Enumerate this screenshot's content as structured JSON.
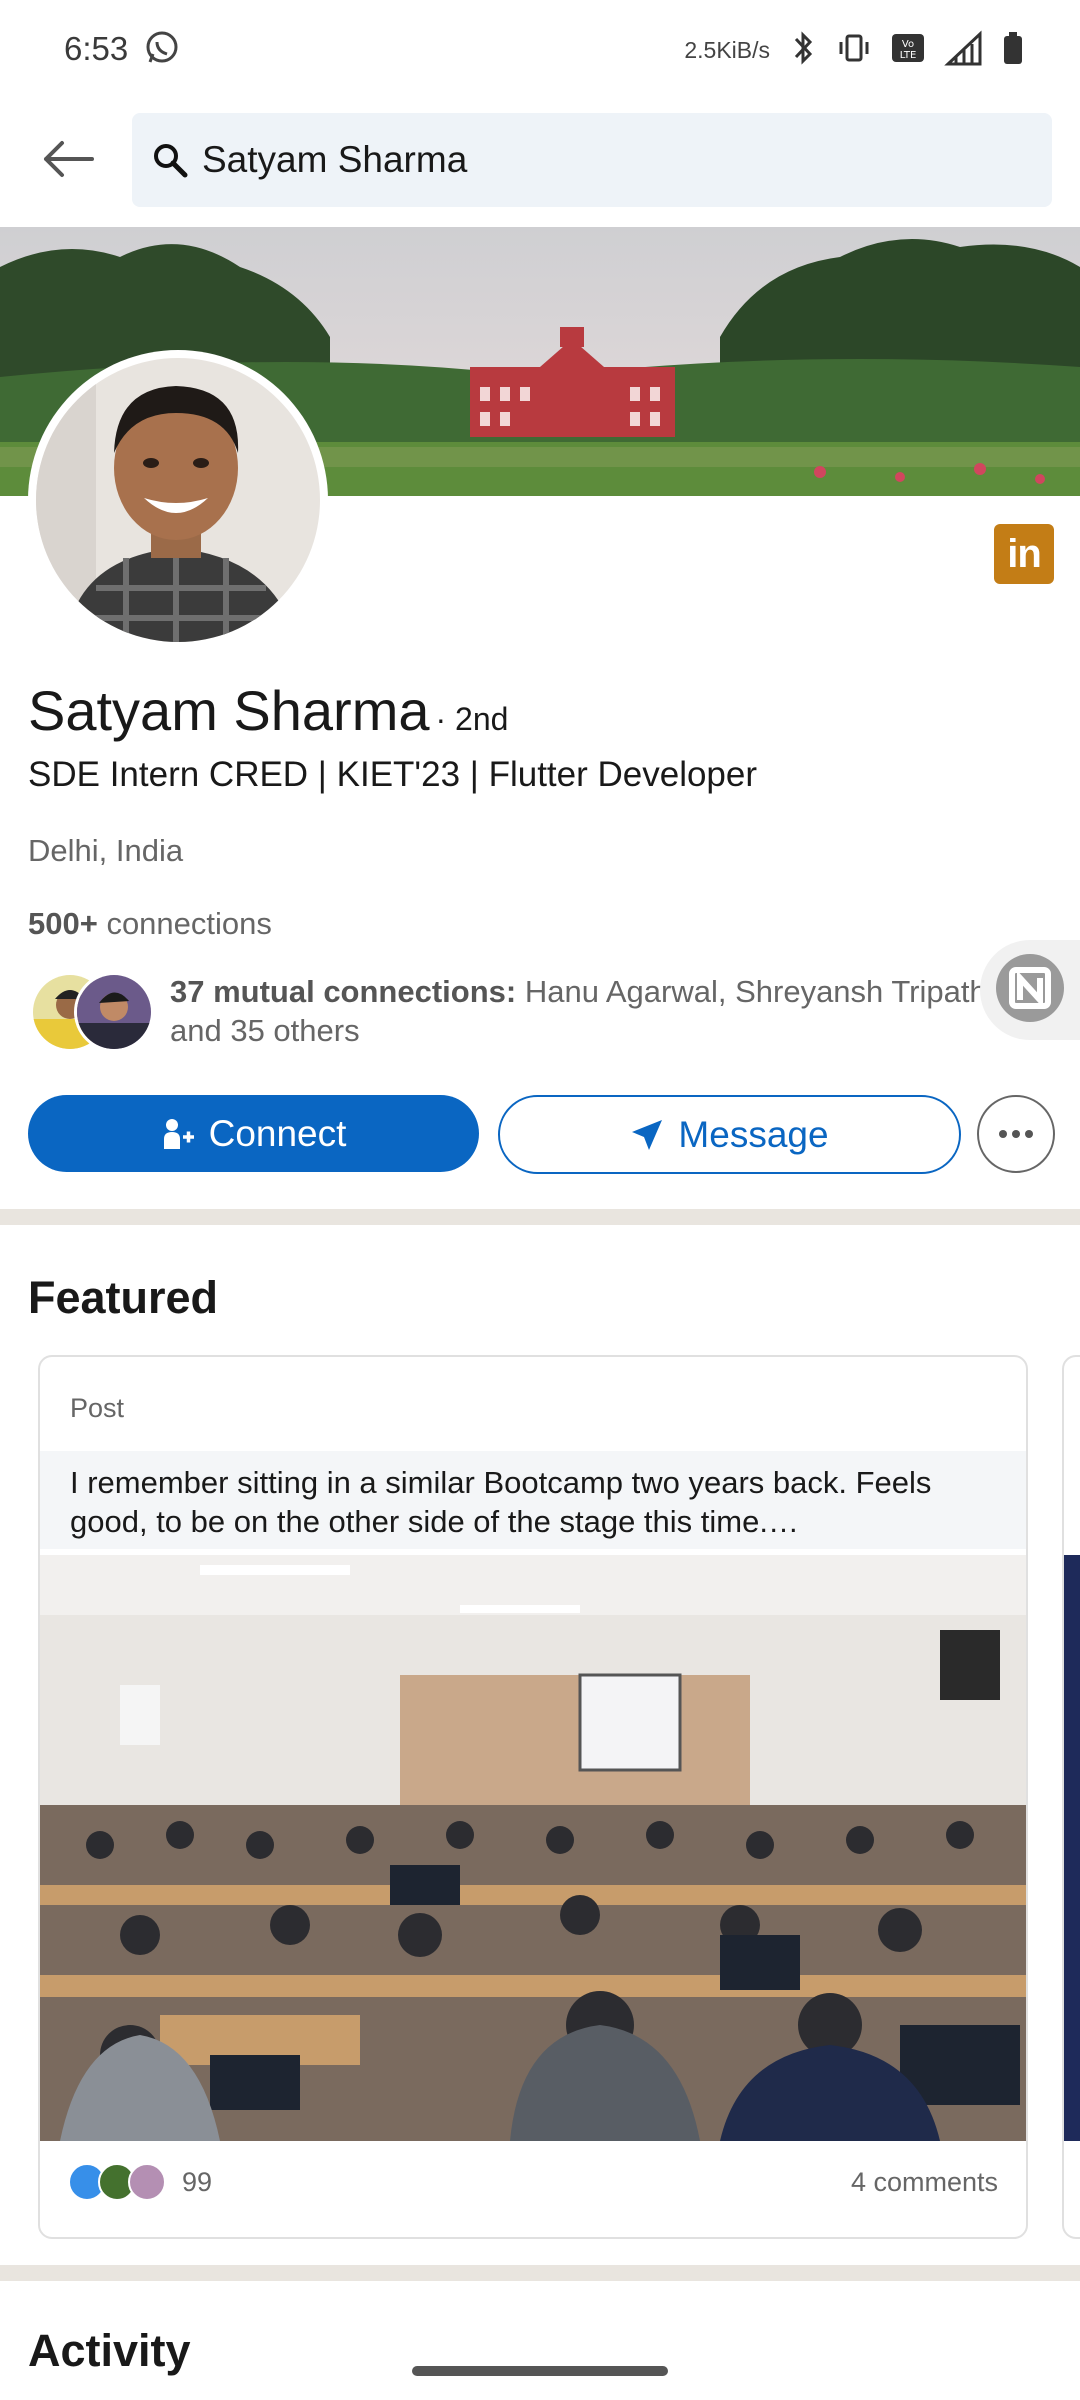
{
  "status_bar": {
    "time": "6:53",
    "net_speed": "2.5KiB/s",
    "icons": [
      "whatsapp-icon",
      "bluetooth-icon",
      "vibrate-icon",
      "volte-icon",
      "signal-icon",
      "battery-icon"
    ]
  },
  "search": {
    "query": "Satyam Sharma"
  },
  "profile": {
    "name": "Satyam Sharma",
    "degree": "· 2nd",
    "headline": "SDE Intern CRED | KIET'23 | Flutter Developer",
    "location": "Delhi, India",
    "connections_count": "500+",
    "connections_label": " connections",
    "mutual_bold": "37 mutual connections:",
    "mutual_rest": " Hanu Agarwal, Shreyansh Tripathi, and 35 others",
    "badge_text": "in"
  },
  "actions": {
    "connect_label": "Connect",
    "message_label": "Message"
  },
  "featured": {
    "title": "Featured",
    "post": {
      "type_label": "Post",
      "excerpt": "I remember sitting in a similar Bootcamp two years back. Feels good, to be on the other side of the stage this time.…",
      "reactions_count": "99",
      "comments": "4 comments"
    }
  },
  "next_section_title": "Activity",
  "colors": {
    "brand_blue": "#0a66c2",
    "linkedin_badge": "#c37d16",
    "divider": "#e9e5df",
    "search_bg": "#eef3f8"
  }
}
